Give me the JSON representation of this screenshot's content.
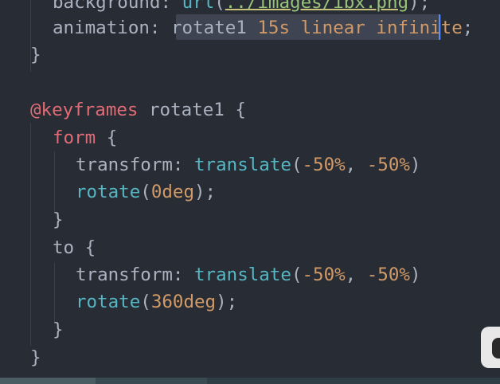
{
  "colors": {
    "background": "#282c35",
    "property": "#abb2bf",
    "punctuation": "#abb2bf",
    "at_rule": "#e06c75",
    "keyword": "#e06c75",
    "function": "#56b6c2",
    "number": "#d19a66",
    "string": "#98c379",
    "selection": "#3e4451",
    "cursor": "#528bff"
  },
  "lines": [
    {
      "tokens": [
        {
          "text": "background: ",
          "kind": "property"
        },
        {
          "text": "url",
          "kind": "function"
        },
        {
          "text": "(",
          "kind": "punctuation"
        },
        {
          "text": "../images/ibx.png",
          "kind": "string"
        },
        {
          "text": ");",
          "kind": "punctuation"
        }
      ]
    },
    {
      "tokens": [
        {
          "text": "animation: ",
          "kind": "property"
        },
        {
          "text": "rotate1 ",
          "kind": "property"
        },
        {
          "text": "15s",
          "kind": "number"
        },
        {
          "text": " linear infinite",
          "kind": "number"
        },
        {
          "text": ";",
          "kind": "punctuation"
        }
      ]
    },
    {
      "tokens": [
        {
          "text": "}",
          "kind": "punctuation"
        }
      ]
    },
    {
      "tokens": []
    },
    {
      "tokens": [
        {
          "text": "@keyframes",
          "kind": "at_rule"
        },
        {
          "text": " rotate1 {",
          "kind": "property"
        }
      ]
    },
    {
      "tokens": [
        {
          "text": "form",
          "kind": "keyword"
        },
        {
          "text": " {",
          "kind": "punctuation"
        }
      ]
    },
    {
      "tokens": [
        {
          "text": "transform: ",
          "kind": "property"
        },
        {
          "text": "translate",
          "kind": "function"
        },
        {
          "text": "(",
          "kind": "punctuation"
        },
        {
          "text": "-50%",
          "kind": "number"
        },
        {
          "text": ", ",
          "kind": "punctuation"
        },
        {
          "text": "-50%",
          "kind": "number"
        },
        {
          "text": ")",
          "kind": "punctuation"
        }
      ]
    },
    {
      "tokens": [
        {
          "text": "rotate",
          "kind": "function"
        },
        {
          "text": "(",
          "kind": "punctuation"
        },
        {
          "text": "0deg",
          "kind": "number"
        },
        {
          "text": ");",
          "kind": "punctuation"
        }
      ]
    },
    {
      "tokens": [
        {
          "text": "}",
          "kind": "punctuation"
        }
      ]
    },
    {
      "tokens": [
        {
          "text": "to",
          "kind": "property"
        },
        {
          "text": " {",
          "kind": "punctuation"
        }
      ]
    },
    {
      "tokens": [
        {
          "text": "transform: ",
          "kind": "property"
        },
        {
          "text": "translate",
          "kind": "function"
        },
        {
          "text": "(",
          "kind": "punctuation"
        },
        {
          "text": "-50%",
          "kind": "number"
        },
        {
          "text": ", ",
          "kind": "punctuation"
        },
        {
          "text": "-50%",
          "kind": "number"
        },
        {
          "text": ")",
          "kind": "punctuation"
        }
      ]
    },
    {
      "tokens": [
        {
          "text": "rotate",
          "kind": "function"
        },
        {
          "text": "(",
          "kind": "punctuation"
        },
        {
          "text": "360deg",
          "kind": "number"
        },
        {
          "text": ");",
          "kind": "punctuation"
        }
      ]
    },
    {
      "tokens": [
        {
          "text": "}",
          "kind": "punctuation"
        }
      ]
    },
    {
      "tokens": [
        {
          "text": "}",
          "kind": "punctuation"
        }
      ]
    }
  ]
}
